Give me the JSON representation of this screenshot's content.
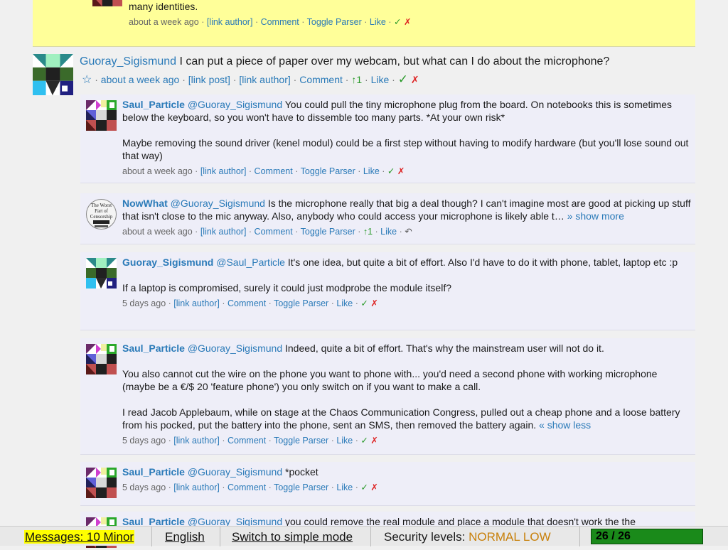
{
  "top_comment": {
    "text": "many identities.",
    "meta": {
      "time": "about a week ago",
      "link_author": "[link author]",
      "comment": "Comment",
      "toggle_parser": "Toggle Parser",
      "like": "Like",
      "check": "✓",
      "cross": "✗"
    }
  },
  "post": {
    "author": "Guoray_Sigismund",
    "text": "I can put a piece of paper over my webcam, but what can I do about the microphone?",
    "star": "☆",
    "time": "about a week ago",
    "link_post": "[link post]",
    "link_author": "[link author]",
    "comment": "Comment",
    "votes": "↑1",
    "like": "Like",
    "check": "✓",
    "cross": "✗"
  },
  "replies": [
    {
      "author": "Saul_Particle",
      "mention": "@Guoray_Sigismund",
      "paragraphs": [
        "You could pull the tiny microphone plug from the board. On notebooks this is sometimes below the keyboard, so you won't have to dissemble too many parts. *At your own risk*",
        "Maybe removing the sound driver (kenel modul) could be a first step without having to modify hardware (but you'll lose sound out that way)"
      ],
      "meta": {
        "time": "about a week ago",
        "link_author": "[link author]",
        "comment": "Comment",
        "toggle_parser": "Toggle Parser",
        "like": "Like",
        "check": "✓",
        "cross": "✗"
      }
    },
    {
      "author": "NowWhat",
      "mention": "@Guoray_Sigismund",
      "paragraphs": [
        "Is the microphone really that big a deal though? I can't imagine most are good at picking up stuff that isn't close to the mic anyway. Also, anybody who could access your microphone is likely able t…"
      ],
      "show_more": "» show more",
      "meta": {
        "time": "about a week ago",
        "link_author": "[link author]",
        "comment": "Comment",
        "toggle_parser": "Toggle Parser",
        "votes": "↑1",
        "like": "Like",
        "undo": "↶"
      }
    },
    {
      "author": "Guoray_Sigismund",
      "mention": "@Saul_Particle",
      "paragraphs": [
        "It's one idea, but quite a bit of effort. Also I'd have to do it with phone, tablet, laptop etc :p",
        "If a laptop is compromised, surely it could just modprobe the module itself?"
      ],
      "meta": {
        "time": "5 days ago",
        "link_author": "[link author]",
        "comment": "Comment",
        "toggle_parser": "Toggle Parser",
        "like": "Like",
        "check": "✓",
        "cross": "✗"
      }
    },
    {
      "author": "Saul_Particle",
      "mention": "@Guoray_Sigismund",
      "paragraphs": [
        "Indeed, quite a bit of effort. That's why the mainstream user will not do it.",
        "You also cannot cut the wire on the phone you want to phone with... you'd need a second phone with working microphone (maybe be a €/$ 20  'feature phone') you only switch on if you want to make a call.",
        "I read Jacob Applebaum, while on stage at the Chaos Communication Congress, pulled out a cheap phone and a loose battery from his pocked, put the battery into the phone, sent an SMS, then removed the battery again."
      ],
      "show_less": "« show less",
      "meta": {
        "time": "5 days ago",
        "link_author": "[link author]",
        "comment": "Comment",
        "toggle_parser": "Toggle Parser",
        "like": "Like",
        "check": "✓",
        "cross": "✗"
      }
    },
    {
      "author": "Saul_Particle",
      "mention": "@Guoray_Sigismund",
      "paragraphs": [
        "*pocket"
      ],
      "meta": {
        "time": "5 days ago",
        "link_author": "[link author]",
        "comment": "Comment",
        "toggle_parser": "Toggle Parser",
        "like": "Like",
        "check": "✓",
        "cross": "✗"
      }
    },
    {
      "author": "Saul_Particle",
      "mention": "@Guoray_Sigismund",
      "paragraphs": [
        "you could remove the real module and place a module that doesn't work the the"
      ]
    }
  ],
  "bottom_bar": {
    "messages": "Messages: 10 Minor",
    "language": "English",
    "simple_mode": "Switch to simple mode",
    "security_label": "Security levels:",
    "security_normal": "NORMAL",
    "security_low": "LOW",
    "counter": "26 / 26"
  },
  "colors": {
    "link": "#2a7ab8",
    "highlight": "#ffff99",
    "reply_bg": "#eeeef8",
    "counter_bg": "#1a8a1a",
    "security": "#c8800a"
  },
  "icons": [
    "identicon-avatar",
    "newspaper-avatar",
    "star-icon",
    "check-icon",
    "cross-icon",
    "undo-icon"
  ]
}
